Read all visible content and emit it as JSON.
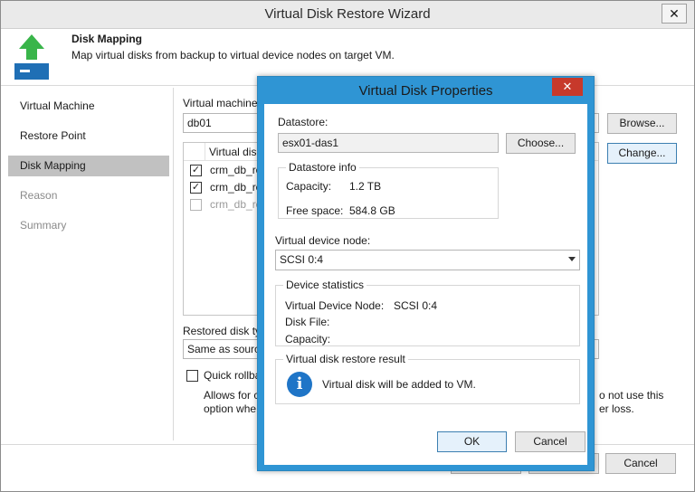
{
  "wizard": {
    "title": "Virtual Disk Restore Wizard",
    "close_glyph": "✕",
    "step_title": "Disk Mapping",
    "step_description": "Map virtual disks from backup to virtual device nodes on target VM."
  },
  "sidebar": {
    "items": [
      {
        "label": "Virtual Machine",
        "state": "normal"
      },
      {
        "label": "Restore Point",
        "state": "normal"
      },
      {
        "label": "Disk Mapping",
        "state": "active"
      },
      {
        "label": "Reason",
        "state": "disabled"
      },
      {
        "label": "Summary",
        "state": "disabled"
      }
    ]
  },
  "content": {
    "vm_label": "Virtual machine",
    "vm_value": "db01",
    "browse_label": "Browse...",
    "change_label": "Change...",
    "grid_header": "Virtual disk",
    "rows": [
      {
        "name": "crm_db_re",
        "checked": true,
        "enabled": true
      },
      {
        "name": "crm_db_re",
        "checked": true,
        "enabled": true
      },
      {
        "name": "crm_db_re",
        "checked": false,
        "enabled": false
      }
    ],
    "disk_type_label": "Restored disk ty",
    "disk_type_value": "Same as source",
    "quick_rollback_label": "Quick rollba",
    "rollback_desc_left_1": "Allows for c",
    "rollback_desc_left_2": "option whe",
    "rollback_desc_right_1": "o not use this",
    "rollback_desc_right_2": "er loss.",
    "cancel_label": "Cancel"
  },
  "dialog": {
    "title": "Virtual Disk Properties",
    "close_glyph": "✕",
    "datastore_label": "Datastore:",
    "datastore_value": "esx01-das1",
    "choose_label": "Choose...",
    "datastore_info_title": "Datastore info",
    "capacity_label": "Capacity:",
    "capacity_value": "1.2 TB",
    "free_space_label": "Free space:",
    "free_space_value": "584.8 GB",
    "device_node_label": "Virtual device node:",
    "device_node_value": "SCSI 0:4",
    "device_stats_title": "Device statistics",
    "vdn_label": "Virtual Device Node:",
    "vdn_value": "SCSI 0:4",
    "disk_file_label": "Disk File:",
    "disk_file_value": "",
    "stat_capacity_label": "Capacity:",
    "stat_capacity_value": "",
    "result_title": "Virtual disk restore result",
    "result_text": "Virtual disk will be added to VM.",
    "ok_label": "OK",
    "cancel_label": "Cancel",
    "accent_color": "#2f95d4"
  }
}
